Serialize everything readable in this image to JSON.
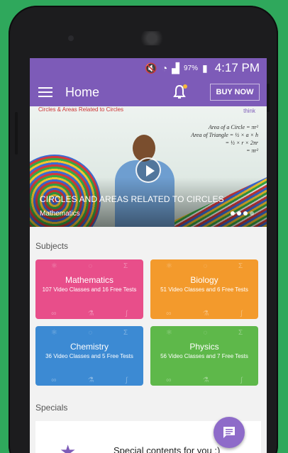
{
  "status_bar": {
    "battery": "97%",
    "time": "4:17 PM"
  },
  "app_bar": {
    "title": "Home",
    "buy_now_label": "BUY NOW"
  },
  "banner": {
    "board_title": "Circles & Areas Related to Circles",
    "board_note": "think",
    "board_lines": [
      "Area of a Circle = πr²",
      "Area of Triangle = ½ × a × h",
      "= ½ × r × 2πr",
      "= πr²"
    ],
    "title": "CIRCLES AND AREAS RELATED TO CIRCLES",
    "subject": "Mathematics"
  },
  "subjects": {
    "heading": "Subjects",
    "items": [
      {
        "name": "Mathematics",
        "desc": "107 Video Classes and 16 Free Tests"
      },
      {
        "name": "Biology",
        "desc": "51 Video Classes and 6 Free Tests"
      },
      {
        "name": "Chemistry",
        "desc": "36 Video Classes and 5 Free Tests"
      },
      {
        "name": "Physics",
        "desc": "56 Video Classes and 7 Free Tests"
      }
    ]
  },
  "specials": {
    "heading": "Specials",
    "card_text": "Special contents for you :)"
  },
  "colors": {
    "primary": "#7d5bb8",
    "math": "#e84e8a",
    "biology": "#f39a2c",
    "chemistry": "#3c8ad3",
    "physics": "#5eb84a"
  },
  "icons": [
    "menu-icon",
    "bell-icon",
    "play-icon",
    "star-icon",
    "chat-icon"
  ]
}
